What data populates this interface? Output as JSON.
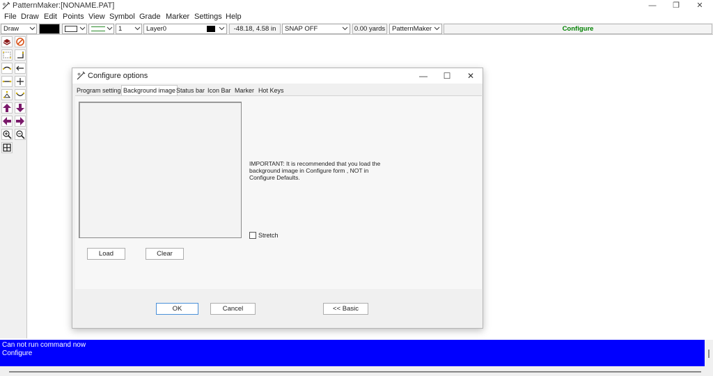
{
  "window": {
    "title": "PatternMaker:[NONAME.PAT]",
    "minimize_glyph": "—",
    "restore_glyph": "❐",
    "close_glyph": "✕"
  },
  "menu": [
    "File",
    "Draw",
    "Edit",
    "Points",
    "View",
    "Symbol",
    "Grade",
    "Marker",
    "Settings",
    "Help"
  ],
  "toolbar": {
    "mode": "Draw",
    "line_width": "1",
    "layer": "Layer0",
    "coordinates": "-48.18, 4.58 in",
    "snap": "SNAP OFF",
    "length": "0.00 yards",
    "app_mode": "PatternMaker",
    "status_panel": "Configure",
    "status_panel_color": "#008000"
  },
  "tools": [
    "layers-icon",
    "no-entry-icon",
    "dotted-rect-icon",
    "corner-icon",
    "curve-line-icon",
    "arrow-line-icon",
    "double-arrow-icon",
    "crosshair-icon",
    "triangle-points-icon",
    "smile-curve-icon",
    "arrow-up-icon",
    "arrow-down-icon",
    "arrow-left-icon",
    "arrow-right-icon",
    "zoom-in-icon",
    "zoom-out-icon",
    "grid-icon"
  ],
  "dialog": {
    "title": "Configure options",
    "tabs": [
      "Program settings",
      "Background image",
      "Status bar",
      "Icon Bar",
      "Marker",
      "Hot Keys"
    ],
    "active_tab": "Background image",
    "load_label": "Load",
    "clear_label": "Clear",
    "important_text": "IMPORTANT: It is recommended that you load the background image in Configure form , NOT in Configure Defaults.",
    "stretch_label": "Stretch",
    "stretch_checked": false,
    "ok_label": "OK",
    "cancel_label": "Cancel",
    "basic_label": "<< Basic",
    "minimize_glyph": "—",
    "maximize_glyph": "☐",
    "close_glyph": "✕"
  },
  "status": {
    "line1": "Can not run command now",
    "line2": "Configure",
    "background": "#0000ff"
  }
}
